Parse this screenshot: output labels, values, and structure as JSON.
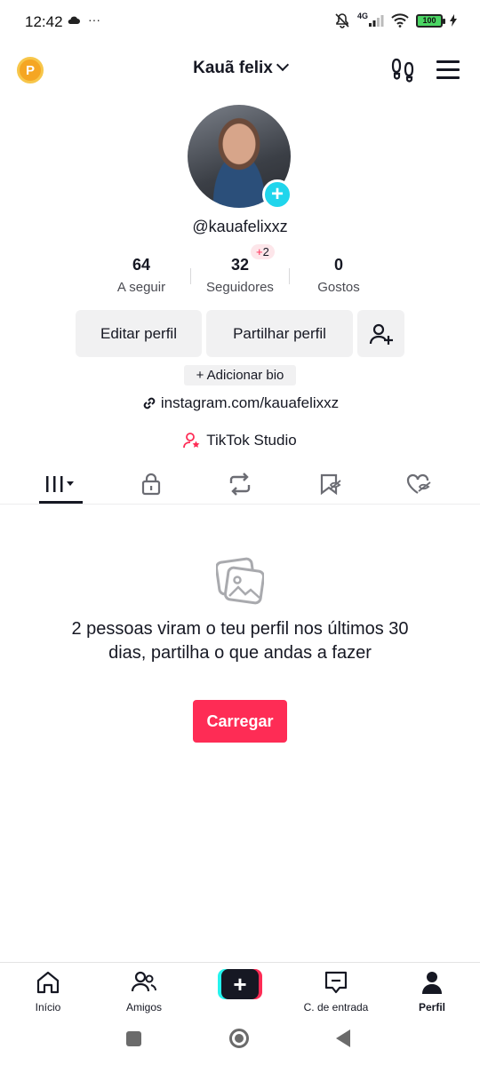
{
  "status_bar": {
    "time": "12:42",
    "dots": "···",
    "network": "4G",
    "battery": "100"
  },
  "header": {
    "coin_letter": "P",
    "title": "Kauã felix"
  },
  "profile": {
    "username": "@kauafelixxz",
    "stats": [
      {
        "value": "64",
        "label": "A seguir"
      },
      {
        "value": "32",
        "label": "Seguidores"
      },
      {
        "value": "0",
        "label": "Gostos"
      }
    ],
    "followers_badge": {
      "plus": "+",
      "count": "2"
    },
    "edit_profile": "Editar perfil",
    "share_profile": "Partilhar perfil",
    "add_bio": "+ Adicionar bio",
    "link": "instagram.com/kauafelixxz",
    "studio": "TikTok Studio"
  },
  "tabs": [
    {
      "icon": "videos-grid-icon"
    },
    {
      "icon": "lock-icon"
    },
    {
      "icon": "repost-icon"
    },
    {
      "icon": "favorites-icon"
    },
    {
      "icon": "liked-icon"
    }
  ],
  "empty_state": {
    "message": "2 pessoas viram o teu perfil nos últimos 30 dias, partilha o que andas a fazer",
    "button": "Carregar"
  },
  "bottom_nav": {
    "home": "Início",
    "friends": "Amigos",
    "create": "+",
    "inbox": "C. de entrada",
    "profile": "Perfil"
  },
  "colors": {
    "accent": "#fe2c55",
    "cyan": "#20d5ec",
    "text": "#161823"
  }
}
